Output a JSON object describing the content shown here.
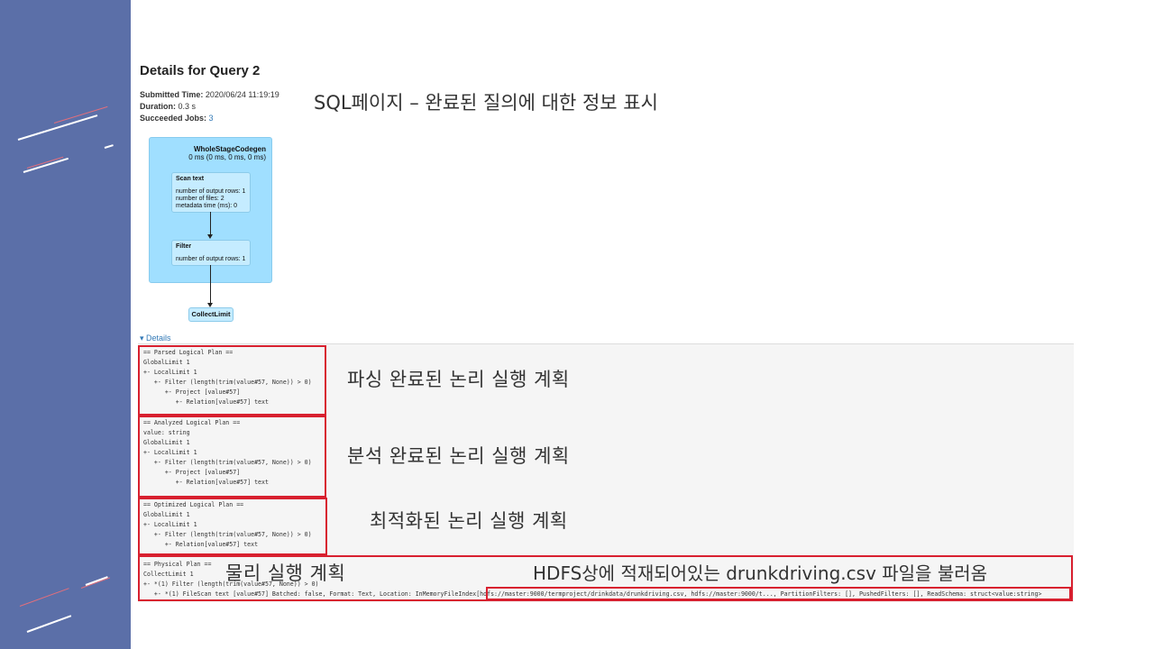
{
  "header": {
    "title": "Details for Query 2",
    "submitted_label": "Submitted Time:",
    "submitted_value": "2020/06/24 11:19:19",
    "duration_label": "Duration:",
    "duration_value": "0.3 s",
    "jobs_label": "Succeeded Jobs:",
    "jobs_value": "3"
  },
  "annotation_title": "SQL페이지 – 완료된 질의에 대한 정보 표시",
  "dag": {
    "cluster_title": "WholeStageCodegen",
    "cluster_subtitle": "0 ms (0 ms, 0 ms, 0 ms)",
    "scan_title": "Scan text",
    "scan_metrics": [
      "number of output rows: 1",
      "number of files: 2",
      "metadata time (ms): 0"
    ],
    "filter_title": "Filter",
    "filter_metric": "number of output rows: 1",
    "collect_title": "CollectLimit"
  },
  "details_toggle": "▾ Details",
  "plans": {
    "parsed": "== Parsed Logical Plan ==\nGlobalLimit 1\n+- LocalLimit 1\n   +- Filter (length(trim(value#57, None)) > 0)\n      +- Project [value#57]\n         +- Relation[value#57] text",
    "analyzed": "== Analyzed Logical Plan ==\nvalue: string\nGlobalLimit 1\n+- LocalLimit 1\n   +- Filter (length(trim(value#57, None)) > 0)\n      +- Project [value#57]\n         +- Relation[value#57] text",
    "optimized": "== Optimized Logical Plan ==\nGlobalLimit 1\n+- LocalLimit 1\n   +- Filter (length(trim(value#57, None)) > 0)\n      +- Relation[value#57] text",
    "physical": "== Physical Plan ==\nCollectLimit 1\n+- *(1) Filter (length(trim(value#57, None)) > 0)\n   +- *(1) FileScan text [value#57] Batched: false, Format: Text, Location: InMemoryFileIndex[hdfs://master:9000/termproject/drinkdata/drunkdriving.csv, hdfs://master:9000/t..., PartitionFilters: [], PushedFilters: [], ReadSchema: struct<value:string>"
  },
  "annotations": {
    "parsed": "파싱 완료된 논리 실행 계획",
    "analyzed": "분석 완료된 논리 실행 계획",
    "optimized": "최적화된 논리 실행 계획",
    "physical": "물리 실행 계획",
    "hdfs": "HDFS상에 적재되어있는 drunkdriving.csv 파일을 불러옴"
  },
  "colors": {
    "sidebar": "#5b6fa8",
    "highlight": "#d8202f",
    "dag_cluster": "#a0dfff",
    "dag_node": "#c5ecff",
    "link": "#337ab7"
  }
}
